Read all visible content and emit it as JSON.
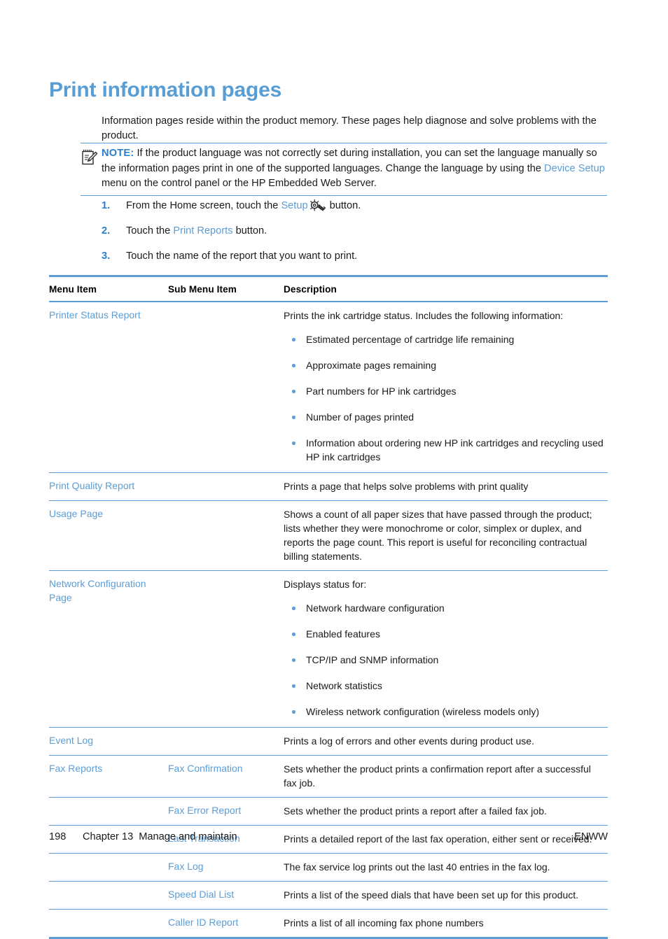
{
  "title": "Print information pages",
  "intro": "Information pages reside within the product memory. These pages help diagnose and solve problems with the product.",
  "note": {
    "label": "NOTE:",
    "text_before_link": "If the product language was not correctly set during installation, you can set the language manually so the information pages print in one of the supported languages. Change the language by using the ",
    "link": "Device Setup",
    "text_after_link": " menu on the control panel or the HP Embedded Web Server.",
    "icon": "note-pencil-icon"
  },
  "steps": [
    {
      "num": "1.",
      "text_before_link": "From the Home screen, touch the ",
      "link": "Setup",
      "icon": "wrench-gear-icon",
      "text_after_link": " button."
    },
    {
      "num": "2.",
      "text_before_link": "Touch the ",
      "link": "Print Reports",
      "icon": "",
      "text_after_link": " button."
    },
    {
      "num": "3.",
      "text_before_link": "Touch the name of the report that you want to print.",
      "link": "",
      "icon": "",
      "text_after_link": ""
    }
  ],
  "table": {
    "headers": {
      "menu_item": "Menu Item",
      "sub_menu_item": "Sub Menu Item",
      "description": "Description"
    },
    "rows": [
      {
        "menu_item": "Printer Status Report",
        "sub_menu_item": "",
        "description": "Prints the ink cartridge status. Includes the following information:",
        "bullets": [
          "Estimated percentage of cartridge life remaining",
          "Approximate pages remaining",
          "Part numbers for HP ink cartridges",
          "Number of pages printed",
          "Information about ordering new HP ink cartridges and recycling used HP ink cartridges"
        ]
      },
      {
        "menu_item": "Print Quality Report",
        "sub_menu_item": "",
        "description": "Prints a page that helps solve problems with print quality",
        "bullets": []
      },
      {
        "menu_item": "Usage Page",
        "sub_menu_item": "",
        "description": "Shows a count of all paper sizes that have passed through the product; lists whether they were monochrome or color, simplex or duplex, and reports the page count. This report is useful for reconciling contractual billing statements.",
        "bullets": []
      },
      {
        "menu_item": "Network Configuration Page",
        "sub_menu_item": "",
        "description": "Displays status for:",
        "bullets": [
          "Network hardware configuration",
          "Enabled features",
          "TCP/IP and SNMP information",
          "Network statistics",
          "Wireless network configuration (wireless models only)"
        ]
      },
      {
        "menu_item": "Event Log",
        "sub_menu_item": "",
        "description": "Prints a log of errors and other events during product use.",
        "bullets": []
      },
      {
        "menu_item": "Fax Reports",
        "sub_menu_item": "Fax Confirmation",
        "description": "Sets whether the product prints a confirmation report after a successful fax job.",
        "bullets": []
      },
      {
        "menu_item": "",
        "sub_menu_item": "Fax Error Report",
        "description": "Sets whether the product prints a report after a failed fax job.",
        "bullets": []
      },
      {
        "menu_item": "",
        "sub_menu_item": "Last Transaction",
        "description": "Prints a detailed report of the last fax operation, either sent or received.",
        "bullets": []
      },
      {
        "menu_item": "",
        "sub_menu_item": "Fax Log",
        "description": "The fax service log prints out the last 40 entries in the fax log.",
        "bullets": []
      },
      {
        "menu_item": "",
        "sub_menu_item": "Speed Dial List",
        "description": "Prints a list of the speed dials that have been set up for this product.",
        "bullets": []
      },
      {
        "menu_item": "",
        "sub_menu_item": "Caller ID Report",
        "description": "Prints a list of all incoming fax phone numbers",
        "bullets": []
      }
    ]
  },
  "footer": {
    "page_number": "198",
    "chapter": "Chapter 13",
    "chapter_title": "Manage and maintain",
    "locale": "ENWW"
  },
  "colors": {
    "accent_blue": "#5b9dd6",
    "link_blue": "#5b9dd6",
    "heading_blue": "#589dd3",
    "text": "#1a1a1a"
  }
}
